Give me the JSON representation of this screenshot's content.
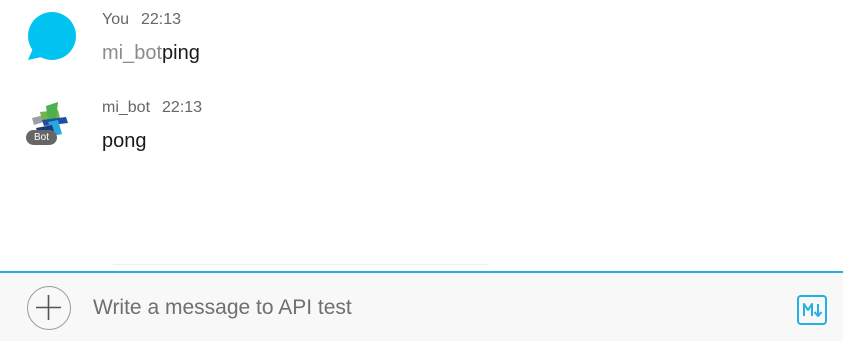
{
  "messages": [
    {
      "sender": "You",
      "time": "22:13",
      "mention": "mi_bot",
      "text": "ping",
      "avatar_icon": "chat-bubble-icon",
      "avatar_color": "#00c4ef"
    },
    {
      "sender": "mi_bot",
      "time": "22:13",
      "text": "pong",
      "avatar_icon": "webex-bot-logo-icon",
      "badge": "Bot"
    }
  ],
  "composer": {
    "placeholder": "Write a message to API test",
    "add_icon": "plus-icon",
    "markdown_icon": "markdown-toggle-icon",
    "accent_color": "#23b1e1"
  }
}
